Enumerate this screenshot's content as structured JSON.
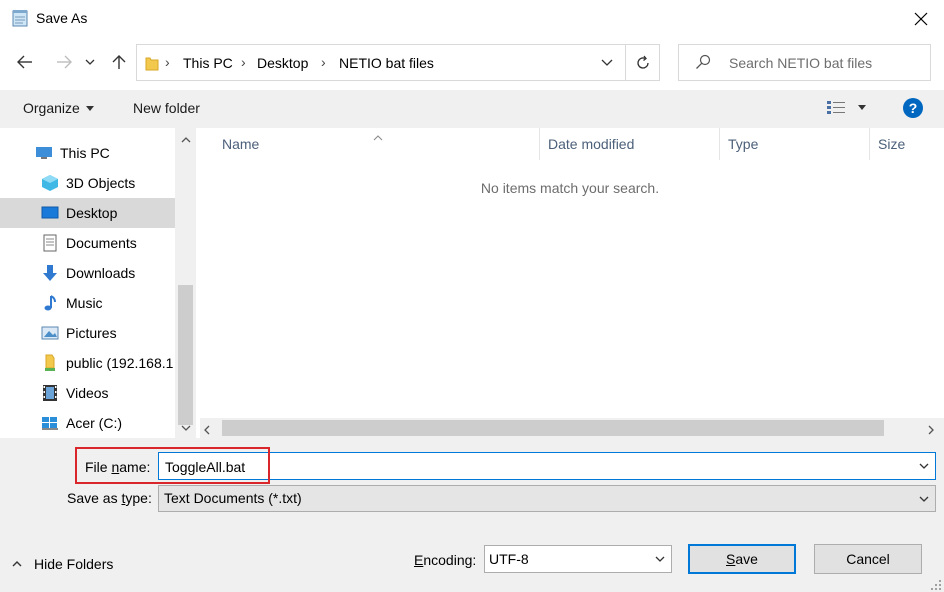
{
  "window": {
    "title": "Save As"
  },
  "nav": {
    "breadcrumbs": [
      "This PC",
      "Desktop",
      "NETIO bat files"
    ]
  },
  "search": {
    "placeholder": "Search NETIO bat files"
  },
  "toolbar": {
    "organize": "Organize",
    "new_folder": "New folder"
  },
  "sidebar": {
    "items": [
      {
        "label": "This PC",
        "icon": "computer-icon"
      },
      {
        "label": "3D Objects",
        "icon": "cube-icon"
      },
      {
        "label": "Desktop",
        "icon": "desktop-icon",
        "selected": true
      },
      {
        "label": "Documents",
        "icon": "documents-icon"
      },
      {
        "label": "Downloads",
        "icon": "download-icon"
      },
      {
        "label": "Music",
        "icon": "music-icon"
      },
      {
        "label": "Pictures",
        "icon": "pictures-icon"
      },
      {
        "label": "public (192.168.1",
        "icon": "network-drive-icon"
      },
      {
        "label": "Videos",
        "icon": "video-icon"
      },
      {
        "label": "Acer (C:)",
        "icon": "drive-icon"
      }
    ]
  },
  "filelist": {
    "columns": [
      "Name",
      "Date modified",
      "Type",
      "Size"
    ],
    "empty_message": "No items match your search."
  },
  "form": {
    "file_name_label_pre": "File ",
    "file_name_label_key": "n",
    "file_name_label_post": "ame:",
    "file_name_value": "ToggleAll.bat",
    "save_type_label_pre": "Save as ",
    "save_type_label_key": "t",
    "save_type_label_post": "ype:",
    "save_type_value": "Text Documents (*.txt)",
    "encoding_label_key": "E",
    "encoding_label_post": "ncoding:",
    "encoding_value": "UTF-8",
    "hide_folders": "Hide Folders",
    "save_key": "S",
    "save_post": "ave",
    "cancel": "Cancel"
  },
  "colors": {
    "accent": "#0078d7",
    "highlight": "#d9262b",
    "selection": "#d9d9d9"
  }
}
